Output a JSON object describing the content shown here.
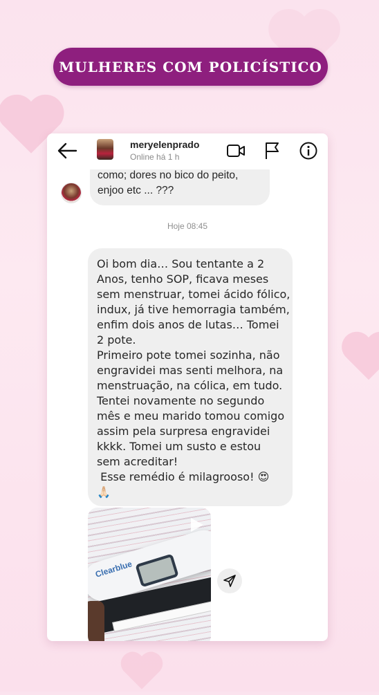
{
  "banner": {
    "title": "MULHERES COM POLICÍSTICO"
  },
  "header": {
    "username": "meryelenprado",
    "status": "Online há 1 h",
    "icons": [
      "arrow-left-icon",
      "video-camera-icon",
      "flag-icon",
      "info-icon"
    ]
  },
  "messages": {
    "previous_text": "como; dores no bico do peito,\nenjoo etc ... ???",
    "timestamp": "Hoje 08:45",
    "main_text": "Oi bom dia… Sou tentante a 2\nAnos, tenho SOP, ficava meses\nsem menstruar, tomei ácido fólico,\nindux, já tive hemorragia também,\nenfim dois anos de lutas… Tomei\n2 pote.\nPrimeiro pote tomei sozinha, não\nengravidei mas senti melhora, na\nmenstruação, na cólica, em tudo.\nTentei novamente no segundo\nmês e meu marido tomou comigo\nassim pela surpresa engravidei\nkkkk. Tomei um susto e estou\nsem acreditar!\n Esse remédio é milagrooso! 😍\n🙏🏻",
    "photo_brand": "Clearblue"
  },
  "colors": {
    "banner_bg": "#8e1f7e",
    "bubble_bg": "#efefef",
    "page_bg": "#fbe3ee"
  }
}
